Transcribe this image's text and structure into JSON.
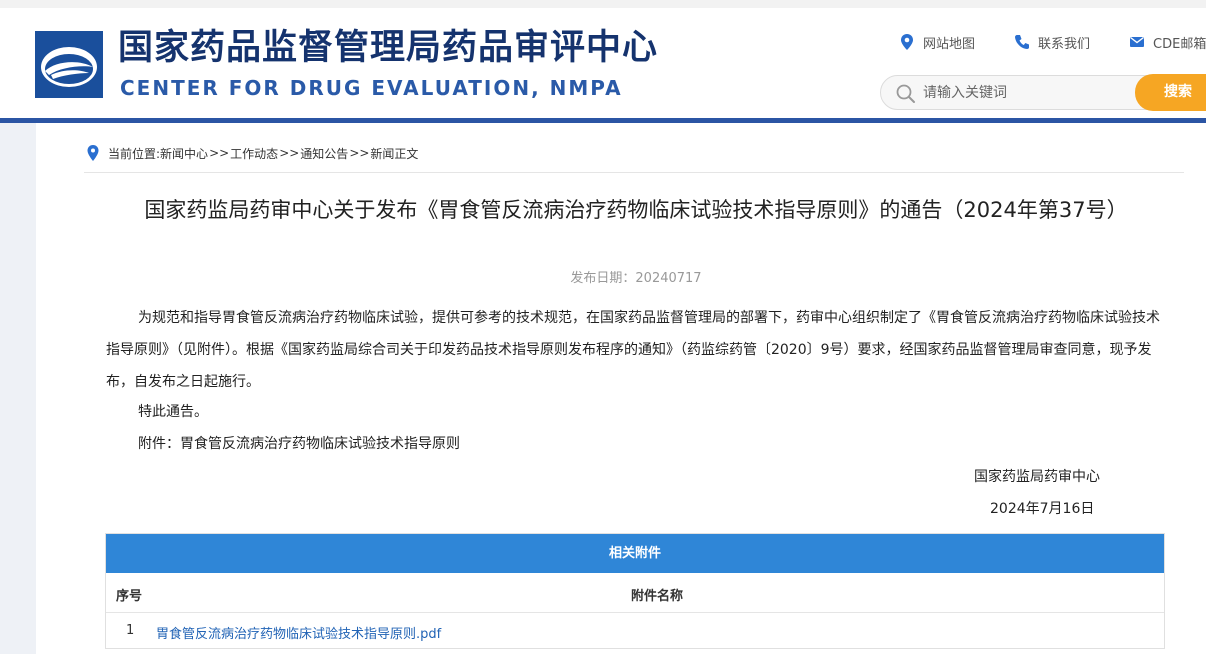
{
  "header": {
    "site_name_cn": "国家药品监督管理局药品审评中心",
    "site_name_en": "CENTER FOR DRUG EVALUATION, NMPA",
    "links": [
      {
        "label": "网站地图",
        "icon": "location-pin-icon"
      },
      {
        "label": "联系我们",
        "icon": "phone-icon"
      },
      {
        "label": "CDE邮箱",
        "icon": "mail-icon"
      }
    ],
    "search_placeholder": "请输入关键词",
    "search_button": "搜索",
    "brand_color": "#15336e",
    "accent_color": "#f6a623"
  },
  "breadcrumb": {
    "prefix": "当前位置:",
    "items": [
      "新闻中心",
      "工作动态",
      "通知公告",
      "新闻正文"
    ],
    "separator": ">>"
  },
  "article": {
    "title": "国家药监局药审中心关于发布《胃食管反流病治疗药物临床试验技术指导原则》的通告（2024年第37号）",
    "pub_date": "发布日期：20240717",
    "paragraph": "为规范和指导胃食管反流病治疗药物临床试验，提供可参考的技术规范，在国家药品监督管理局的部署下，药审中心组织制定了《胃食管反流病治疗药物临床试验技术指导原则》（见附件）。根据《国家药监局综合司关于印发药品技术指导原则发布程序的通知》（药监综药管〔2020〕9号）要求，经国家药品监督管理局审查同意，现予发布，自发布之日起施行。",
    "notice": "特此通告。",
    "attachment_line": "附件：胃食管反流病治疗药物临床试验技术指导原则",
    "sign_org": "国家药监局药审中心",
    "sign_date": "2024年7月16日"
  },
  "attachments": {
    "heading": "相关附件",
    "col_no": "序号",
    "col_name": "附件名称",
    "rows": [
      {
        "no": "1",
        "name": "胃食管反流病治疗药物临床试验技术指导原则.pdf"
      }
    ],
    "header_color": "#2f86d7"
  }
}
